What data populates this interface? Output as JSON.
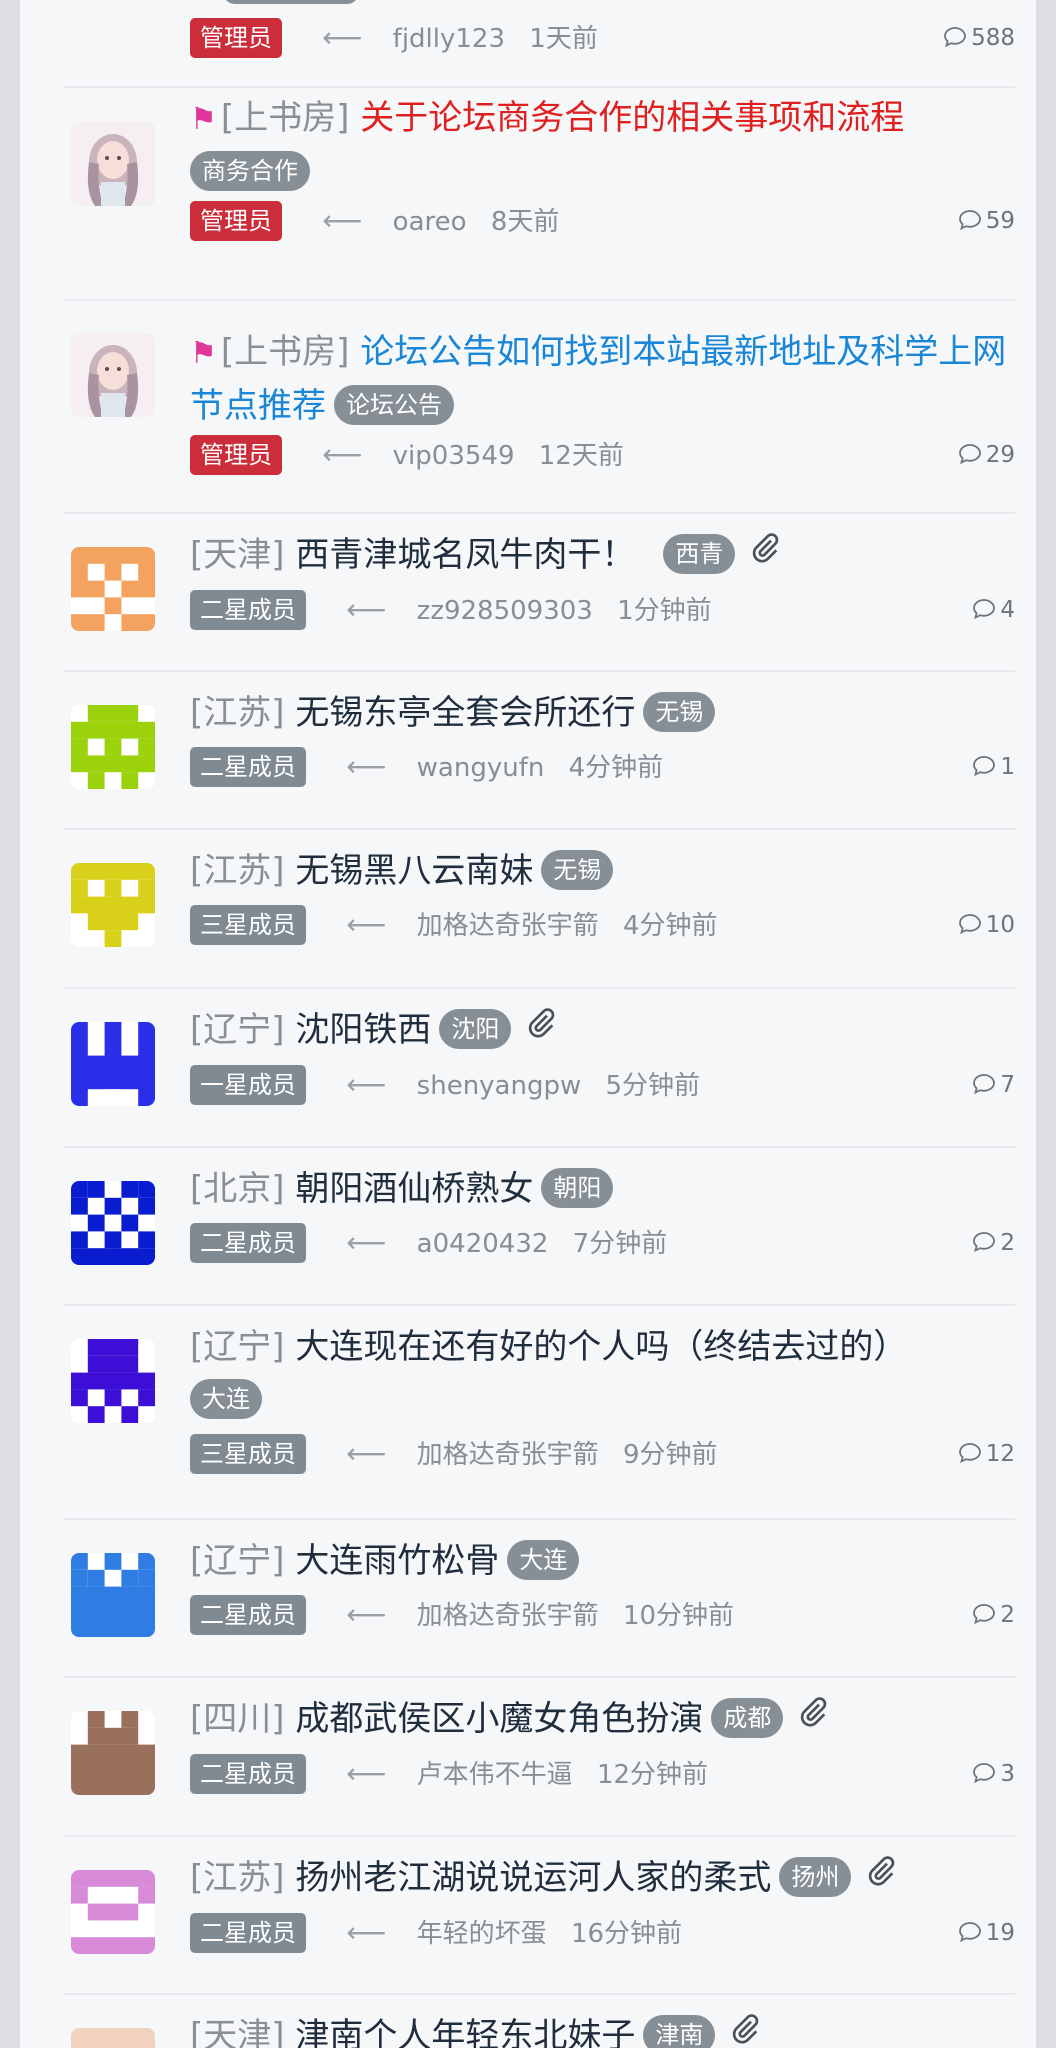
{
  "threads": [
    {
      "forum": "",
      "title": "",
      "title_style": "normal",
      "tag": "",
      "badge": "管理员",
      "author": "fjdlly123",
      "time": "1天前",
      "replies": "588",
      "avatar": "none"
    },
    {
      "forum": "[上书房]",
      "title": "关于论坛商务合作的相关事项和流程",
      "title_style": "red",
      "tag": "商务合作",
      "badge": "管理员",
      "author": "oareo",
      "time": "8天前",
      "replies": "59",
      "avatar": "photo"
    },
    {
      "forum": "[上书房]",
      "title": "论坛公告如何找到本站最新地址及科学上网节点推荐",
      "title_style": "blue",
      "tag": "论坛公告",
      "badge": "管理员",
      "author": "vip03549",
      "time": "12天前",
      "replies": "29",
      "avatar": "photo"
    },
    {
      "forum": "[天津]",
      "title": "西青津城名凤牛肉干！",
      "title_style": "normal",
      "tag": "西青",
      "badge": "二星成员",
      "author": "zz928509303",
      "time": "1分钟前",
      "replies": "4",
      "avatar": "orange"
    },
    {
      "forum": "[江苏]",
      "title": "无锡东亭全套会所还行",
      "title_style": "normal",
      "tag": "无锡",
      "badge": "二星成员",
      "author": "wangyufn",
      "time": "4分钟前",
      "replies": "1",
      "avatar": "lime"
    },
    {
      "forum": "[江苏]",
      "title": "无锡黑八云南妹",
      "title_style": "normal",
      "tag": "无锡",
      "badge": "三星成员",
      "author": "加格达奇张宇箭",
      "time": "4分钟前",
      "replies": "10",
      "avatar": "yellow"
    },
    {
      "forum": "[辽宁]",
      "title": "沈阳铁西",
      "title_style": "normal",
      "tag": "沈阳",
      "badge": "一星成员",
      "author": "shenyangpw",
      "time": "5分钟前",
      "replies": "7",
      "avatar": "blue"
    },
    {
      "forum": "[北京]",
      "title": "朝阳酒仙桥熟女",
      "title_style": "normal",
      "tag": "朝阳",
      "badge": "二星成员",
      "author": "a0420432",
      "time": "7分钟前",
      "replies": "2",
      "avatar": "navy"
    },
    {
      "forum": "[辽宁]",
      "title": "大连现在还有好的个人吗（终结去过的）",
      "title_style": "normal",
      "tag": "大连",
      "badge": "三星成员",
      "author": "加格达奇张宇箭",
      "time": "9分钟前",
      "replies": "12",
      "avatar": "purple"
    },
    {
      "forum": "[辽宁]",
      "title": "大连雨竹松骨",
      "title_style": "normal",
      "tag": "大连",
      "badge": "二星成员",
      "author": "加格达奇张宇箭",
      "time": "10分钟前",
      "replies": "2",
      "avatar": "skyblue"
    },
    {
      "forum": "[四川]",
      "title": "成都武侯区小魔女角色扮演",
      "title_style": "normal",
      "tag": "成都",
      "badge": "二星成员",
      "author": "卢本伟不牛逼",
      "time": "12分钟前",
      "replies": "3",
      "avatar": "brown"
    },
    {
      "forum": "[江苏]",
      "title": "扬州老江湖说说运河人家的柔式",
      "title_style": "normal",
      "tag": "扬州",
      "badge": "二星成员",
      "author": "年轻的坏蛋",
      "time": "16分钟前",
      "replies": "19",
      "avatar": "pink"
    },
    {
      "forum": "[天津]",
      "title": "津南个人年轻东北妹子",
      "title_style": "normal",
      "tag": "津南",
      "badge": "",
      "author": "",
      "time": "",
      "replies": "",
      "avatar": "peach"
    }
  ],
  "colors": {
    "admin_badge": "#cc2d3a",
    "member_badge": "#808a93",
    "tag_bg": "#868e96",
    "title_red": "#e02020",
    "title_blue": "#1a86d6",
    "flag": "#e0359a"
  }
}
